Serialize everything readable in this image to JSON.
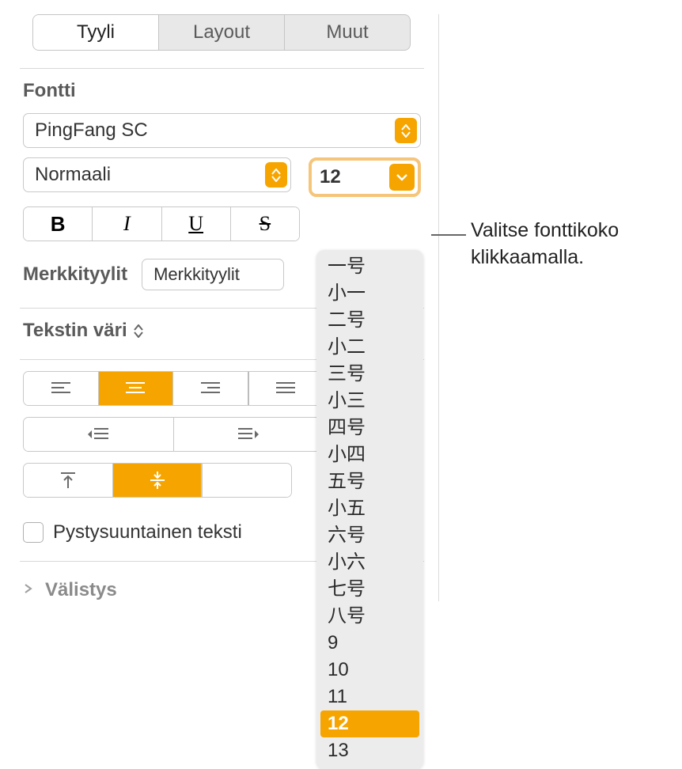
{
  "tabs": {
    "style": "Tyyli",
    "layout": "Layout",
    "more": "Muut"
  },
  "font": {
    "section_label": "Fontti",
    "family": "PingFang SC",
    "weight": "Normaali",
    "size_value": "12",
    "bold": "B",
    "italic": "I",
    "underline": "U",
    "strike": "S"
  },
  "char_styles": {
    "label": "Merkkityylit",
    "value": "Merkkityylit"
  },
  "text_color_label": "Tekstin väri",
  "vertical_text_label": "Pystysuuntainen teksti",
  "spacing_label": "Välistys",
  "size_menu": {
    "items": [
      "一号",
      "小一",
      "二号",
      "小二",
      "三号",
      "小三",
      "四号",
      "小四",
      "五号",
      "小五",
      "六号",
      "小六",
      "七号",
      "八号",
      "9",
      "10",
      "11",
      "12",
      "13"
    ],
    "selected": "12"
  },
  "callout": "Valitse fonttikoko klikkaamalla."
}
